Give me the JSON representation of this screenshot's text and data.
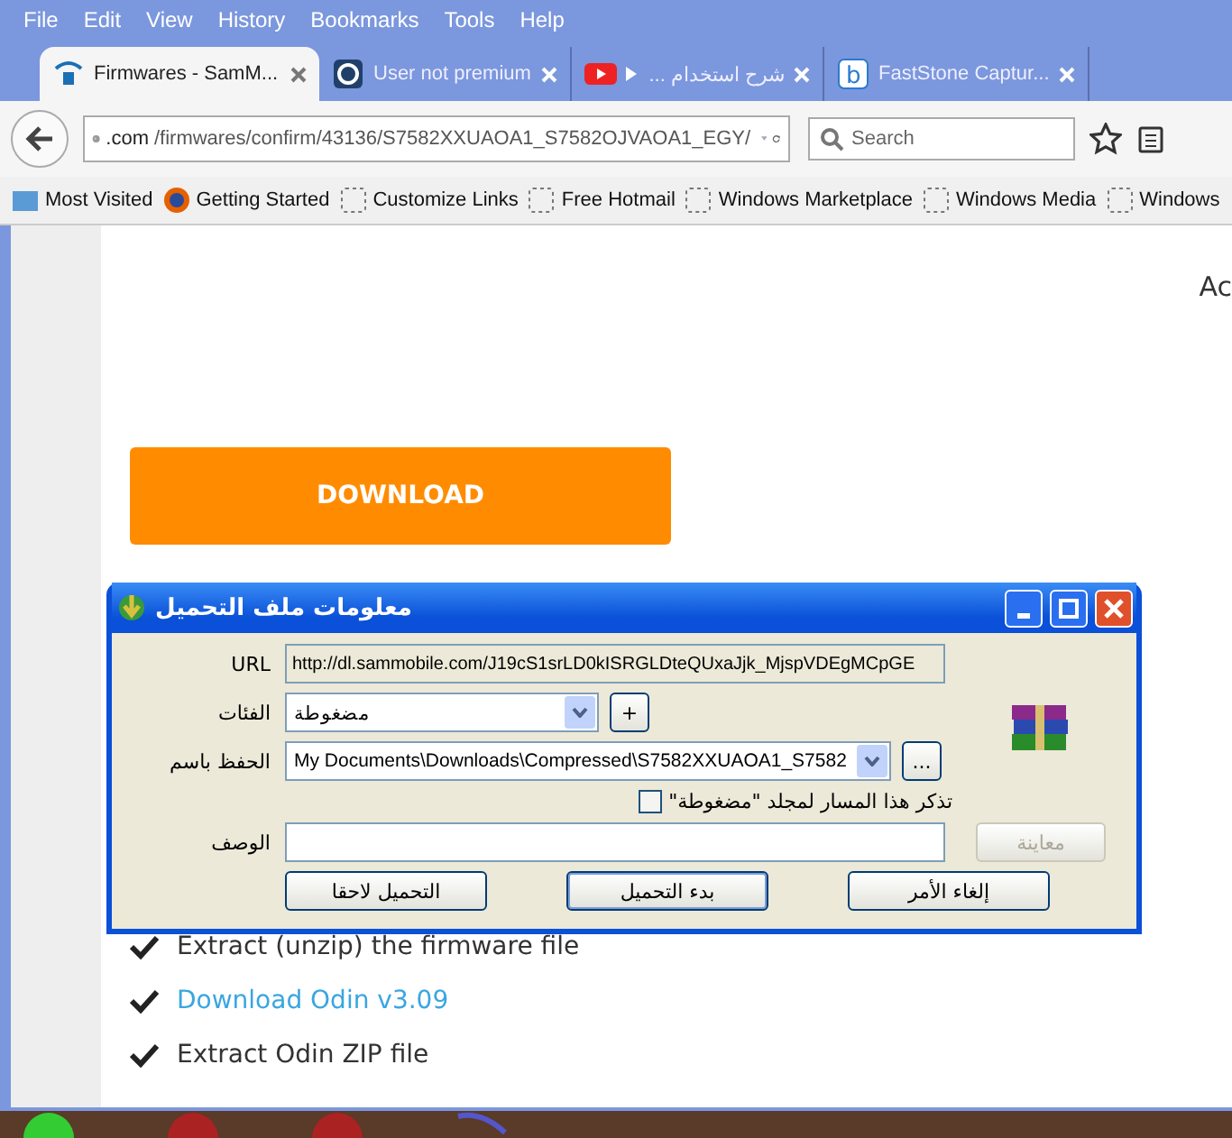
{
  "menu": [
    "File",
    "Edit",
    "View",
    "History",
    "Bookmarks",
    "Tools",
    "Help"
  ],
  "tabs": [
    {
      "title": "Firmwares - SamM...",
      "kind": "samsung",
      "selected": true
    },
    {
      "title": "User not premium",
      "kind": "g",
      "selected": false
    },
    {
      "title": "شرح استخدام ...",
      "kind": "youtube",
      "selected": false
    },
    {
      "title": "FastStone Captur...",
      "kind": "b",
      "selected": false
    }
  ],
  "address": {
    "host": ".com",
    "path": "/firmwares/confirm/43136/S7582XXUAOA1_S7582OJVAOA1_EGY/"
  },
  "search": {
    "placeholder": "Search"
  },
  "bookmarks": [
    {
      "label": "Most Visited",
      "kind": "folder"
    },
    {
      "label": "Getting Started",
      "kind": "firefox"
    },
    {
      "label": "Customize Links",
      "kind": "page"
    },
    {
      "label": "Free Hotmail",
      "kind": "page"
    },
    {
      "label": "Windows Marketplace",
      "kind": "page"
    },
    {
      "label": "Windows Media",
      "kind": "page"
    },
    {
      "label": "Windows",
      "kind": "page"
    }
  ],
  "page": {
    "side_text": "Ac",
    "download_button": "DOWNLOAD",
    "steps": [
      {
        "text": "Extract (unzip) the firmware file",
        "kind": "text"
      },
      {
        "text": "Download Odin v3.09",
        "kind": "link"
      },
      {
        "text": "Extract Odin ZIP file",
        "kind": "text"
      }
    ]
  },
  "dialog": {
    "title": "معلومات ملف التحميل",
    "url_label": "URL",
    "url_value": "http://dl.sammobile.com/J19cS1srLD0kISRGLDteQUxaJjk_MjspVDEgMCpGE",
    "category_label": "الفئات",
    "category_value": "مضغوطة",
    "add_button": "+",
    "save_label": "الحفظ باسم",
    "save_value": "My Documents\\Downloads\\Compressed\\S7582XXUAOA1_S7582",
    "browse_button": "...",
    "remember": {
      "label": "تذكر هذا المسار لمجلد \"مضغوطة\"",
      "checked": false
    },
    "description_label": "الوصف",
    "preview": {
      "label": "معاينة",
      "disabled": true
    },
    "buttons": [
      {
        "label": "إلغاء الأمر",
        "default": false
      },
      {
        "label": "بدء التحميل",
        "default": true
      },
      {
        "label": "التحميل لاحقا",
        "default": false
      }
    ]
  }
}
